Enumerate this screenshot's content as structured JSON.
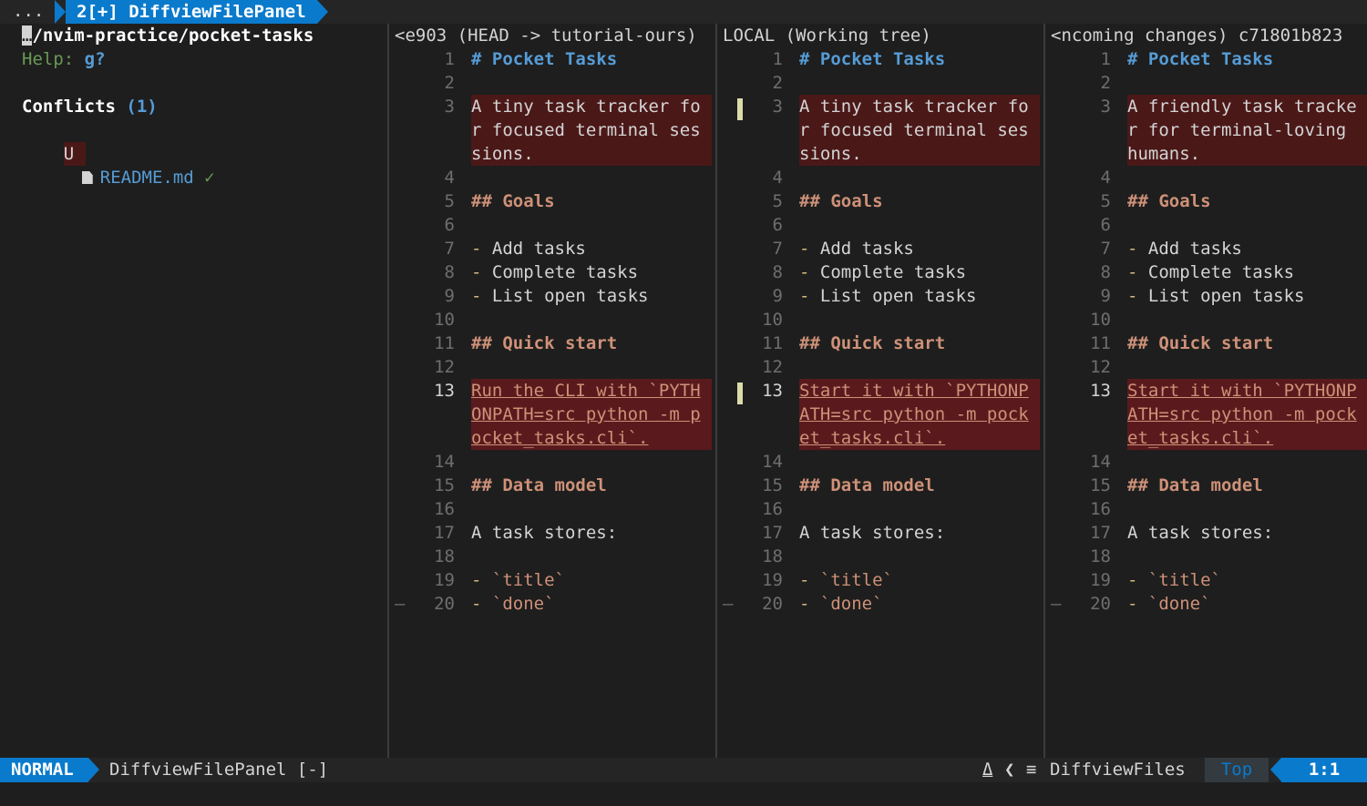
{
  "tabline": {
    "dots": "...",
    "active_tab": "2[+] DiffviewFilePanel"
  },
  "panel": {
    "path_cursor": "…",
    "path": "/nvim-practice/pocket-tasks",
    "help_label": "Help:",
    "help_key": "g?",
    "conflicts_label": "Conflicts",
    "conflicts_count": "(1)",
    "file_status": "U",
    "file_icon": "file-icon",
    "file_name": "README.md",
    "file_check": "✓"
  },
  "panes": [
    {
      "title": "<e903 (HEAD -> tutorial-ours)",
      "line3": [
        "A tiny task tracker fo",
        "r focused terminal ses",
        "sions."
      ],
      "line13": [
        "Run the CLI with `PYTH",
        "ONPATH=src python -m p",
        "ocket_tasks.cli`."
      ]
    },
    {
      "title": "LOCAL (Working tree)",
      "line3": [
        "A tiny task tracker fo",
        "r focused terminal ses",
        "sions."
      ],
      "line13": [
        "Start it with `PYTHONP",
        "ATH=src python -m pock",
        "et_tasks.cli`."
      ]
    },
    {
      "title": "<ncoming changes) c71801b823",
      "line3": [
        "A friendly task tracke",
        "r for terminal-loving",
        "humans."
      ],
      "line13": [
        "Start it with `PYTHONP",
        "ATH=src python -m pock",
        "et_tasks.cli`."
      ]
    }
  ],
  "common": {
    "h1": "# Pocket Tasks",
    "goals": "## Goals",
    "add": "Add tasks",
    "complete": "Complete tasks",
    "list": "List open tasks",
    "quick": "## Quick start",
    "data": "## Data model",
    "stores": "A task stores:",
    "title": "`title`",
    "done": "`done`",
    "dash": "-",
    "fold": "–"
  },
  "status": {
    "mode": "NORMAL",
    "filename": "DiffviewFilePanel [-]",
    "git_icon": "branch-icon",
    "filetype_icon": "lines-icon",
    "filetype": "DiffviewFiles",
    "position": "Top",
    "cursor": "1:1"
  }
}
